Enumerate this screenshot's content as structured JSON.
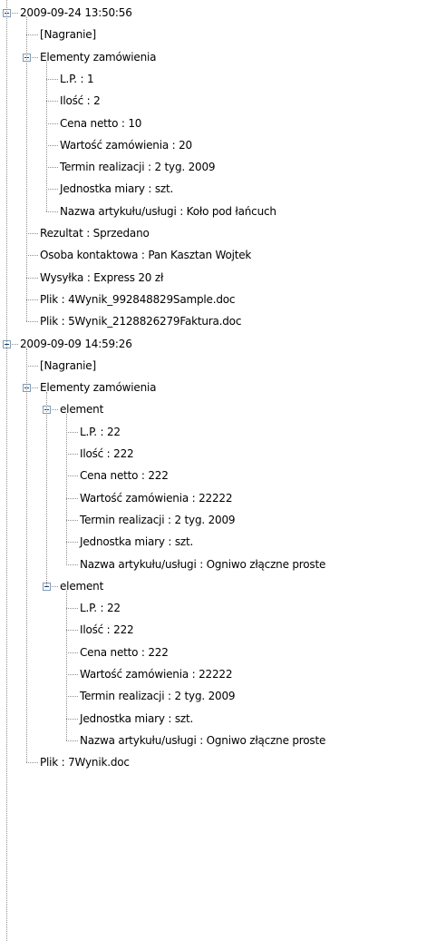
{
  "tree": {
    "rows": [
      {
        "level": 0,
        "expander": true,
        "label": "2009-09-24 13:50:56"
      },
      {
        "level": 1,
        "expander": false,
        "label": "[Nagranie]"
      },
      {
        "level": 1,
        "expander": true,
        "label": "Elementy zamówienia"
      },
      {
        "level": 2,
        "expander": false,
        "label": "L.P. : 1"
      },
      {
        "level": 2,
        "expander": false,
        "label": "Ilość : 2"
      },
      {
        "level": 2,
        "expander": false,
        "label": "Cena netto : 10"
      },
      {
        "level": 2,
        "expander": false,
        "label": "Wartość zamówienia : 20"
      },
      {
        "level": 2,
        "expander": false,
        "label": "Termin realizacji : 2 tyg. 2009"
      },
      {
        "level": 2,
        "expander": false,
        "label": "Jednostka miary : szt."
      },
      {
        "level": 2,
        "expander": false,
        "label": "Nazwa artykułu/usługi : Koło pod łańcuch"
      },
      {
        "level": 1,
        "expander": false,
        "label": "Rezultat : Sprzedano"
      },
      {
        "level": 1,
        "expander": false,
        "label": "Osoba kontaktowa : Pan Kasztan Wojtek"
      },
      {
        "level": 1,
        "expander": false,
        "label": "Wysyłka : Express 20 zł"
      },
      {
        "level": 1,
        "expander": false,
        "label": "Plik : 4Wynik_992848829Sample.doc"
      },
      {
        "level": 1,
        "expander": false,
        "label": "Plik : 5Wynik_2128826279Faktura.doc"
      },
      {
        "level": 0,
        "expander": true,
        "label": "2009-09-09 14:59:26"
      },
      {
        "level": 1,
        "expander": false,
        "label": "[Nagranie]"
      },
      {
        "level": 1,
        "expander": true,
        "label": "Elementy zamówienia"
      },
      {
        "level": 2,
        "expander": true,
        "label": "element"
      },
      {
        "level": 3,
        "expander": false,
        "label": "L.P. : 22"
      },
      {
        "level": 3,
        "expander": false,
        "label": "Ilość : 222"
      },
      {
        "level": 3,
        "expander": false,
        "label": "Cena netto : 222"
      },
      {
        "level": 3,
        "expander": false,
        "label": "Wartość zamówienia : 22222"
      },
      {
        "level": 3,
        "expander": false,
        "label": "Termin realizacji : 2 tyg. 2009"
      },
      {
        "level": 3,
        "expander": false,
        "label": "Jednostka miary : szt."
      },
      {
        "level": 3,
        "expander": false,
        "label": "Nazwa artykułu/usługi : Ogniwo złączne proste"
      },
      {
        "level": 2,
        "expander": true,
        "label": "element"
      },
      {
        "level": 3,
        "expander": false,
        "label": "L.P. : 22"
      },
      {
        "level": 3,
        "expander": false,
        "label": "Ilość : 222"
      },
      {
        "level": 3,
        "expander": false,
        "label": "Cena netto : 222"
      },
      {
        "level": 3,
        "expander": false,
        "label": "Wartość zamówienia : 22222"
      },
      {
        "level": 3,
        "expander": false,
        "label": "Termin realizacji : 2 tyg. 2009"
      },
      {
        "level": 3,
        "expander": false,
        "label": "Jednostka miary : szt."
      },
      {
        "level": 3,
        "expander": false,
        "label": "Nazwa artykułu/usługi : Ogniwo złączne proste"
      },
      {
        "level": 1,
        "expander": false,
        "label": "Plik : 7Wynik.doc"
      }
    ]
  }
}
